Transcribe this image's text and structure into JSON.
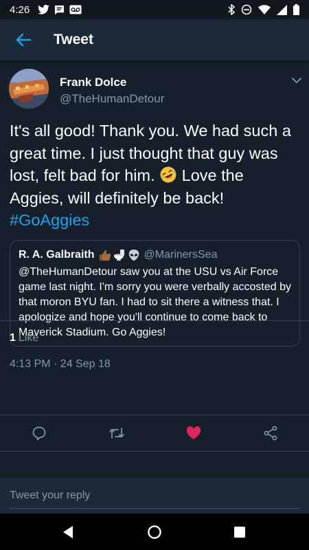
{
  "status_bar": {
    "time": "4:26",
    "left_icons": [
      "twitter-icon",
      "message-icon",
      "voicemail-icon"
    ],
    "right_icons": [
      "bluetooth-icon",
      "do-not-disturb-icon",
      "wifi-icon",
      "signal-icon",
      "battery-icon"
    ]
  },
  "app_bar": {
    "title": "Tweet",
    "back_icon": "back-arrow-icon"
  },
  "tweet": {
    "author_name": "Frank Dolce",
    "author_handle": "@TheHumanDetour",
    "text_part1": "It's all good! Thank you. We had such a great time. I just thought that guy was lost, felt bad for him.",
    "text_part2": "Love the Aggies, will definitely be back!",
    "hashtag": "#GoAggies",
    "emoji": "rolling-on-floor-laughing-emoji",
    "quote": {
      "name": "R. A. Galbraith",
      "name_emojis": [
        "thumbs-up-emoji",
        "toilet-emoji",
        "alien-emoji"
      ],
      "handle": "@MarinersSea",
      "text": "@TheHumanDetour saw you at the USU vs Air Force game last night. I'm sorry you were verbally accosted by that moron BYU fan. I had to sit there a witness that. I apologize and hope you'll continue to come back to Maverick Stadium. Go Aggies!"
    },
    "timestamp": "4:13 PM · 24 Sep 18",
    "likes_count": "1",
    "likes_label": "Like",
    "liked": true
  },
  "actions": [
    "reply-icon",
    "retweet-icon",
    "like-icon",
    "share-icon"
  ],
  "reply": {
    "placeholder": "Tweet your reply"
  },
  "nav": [
    "back-icon",
    "home-icon",
    "recents-icon"
  ],
  "colors": {
    "background": "#15202b",
    "bar": "#1c2938",
    "accent": "#1da1f2",
    "like": "#e0245e",
    "muted": "#8899a6"
  }
}
